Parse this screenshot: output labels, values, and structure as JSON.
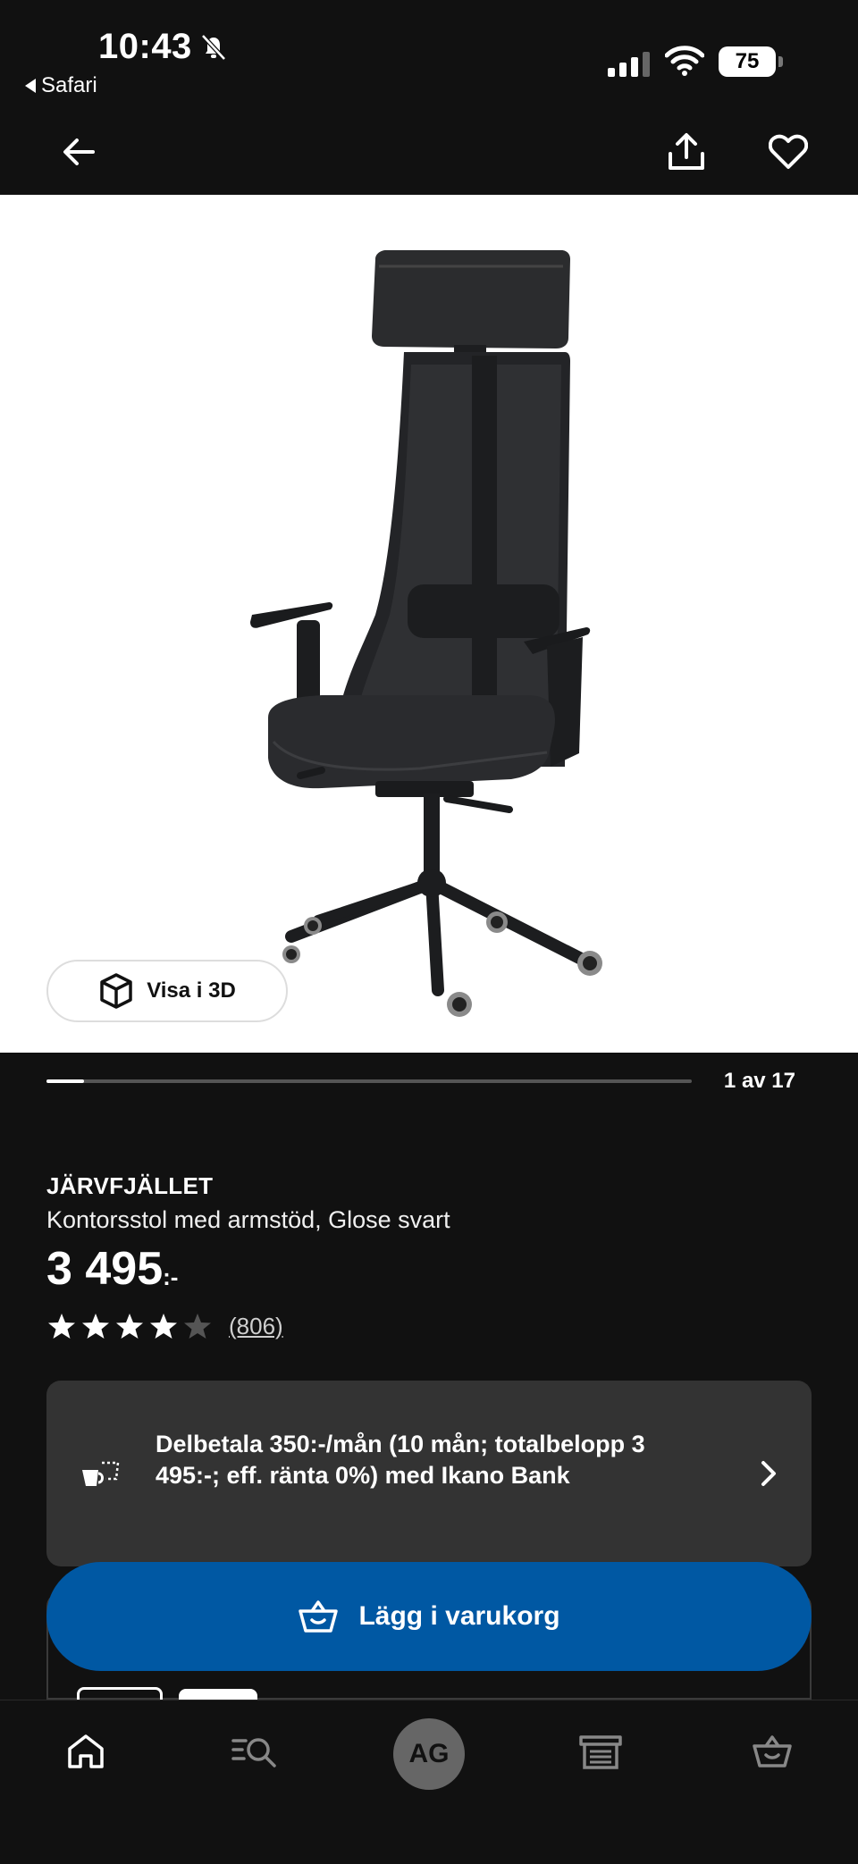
{
  "status_bar": {
    "time": "10:43",
    "back_app": "Safari",
    "battery": "75"
  },
  "gallery": {
    "view_3d_label": "Visa i 3D",
    "counter": "1 av 17",
    "current_index": 1,
    "total": 17
  },
  "product": {
    "name": "JÄRVFJÄLLET",
    "description": "Kontorsstol med armstöd, Glose svart",
    "price": "3 495",
    "price_suffix": ":-",
    "rating": 4,
    "rating_max": 5,
    "review_count": "(806)"
  },
  "financing": {
    "text": "Delbetala 350:-/mån (10 mån; totalbelopp 3 495:-; eff. ränta 0%) med Ikano Bank"
  },
  "cart": {
    "add_label": "Lägg i varukorg"
  },
  "bottom_nav": {
    "avatar_initials": "AG"
  },
  "colors": {
    "background": "#111111",
    "card": "#333333",
    "primary_button": "#0058a3"
  }
}
